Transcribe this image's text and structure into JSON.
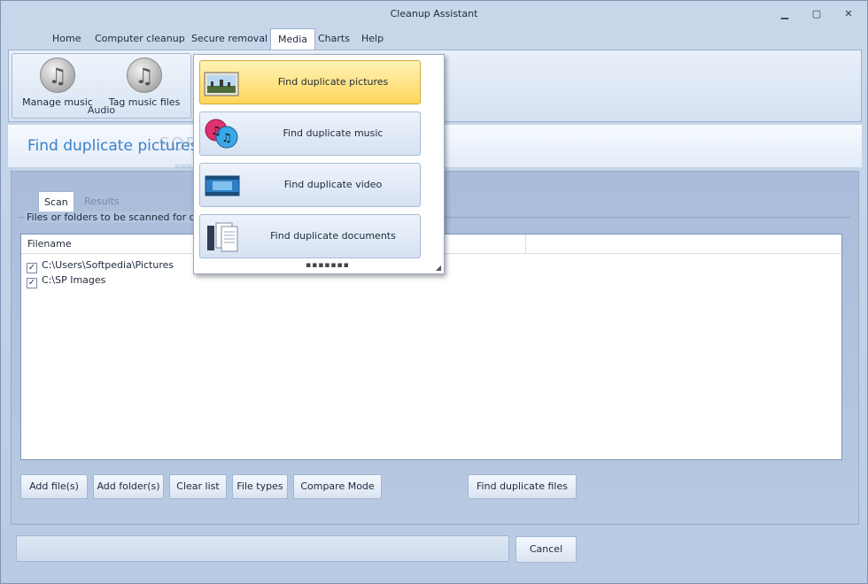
{
  "window": {
    "title": "Cleanup Assistant",
    "controls": {
      "minimize": "▁",
      "maximize": "▢",
      "close": "✕"
    }
  },
  "menu": {
    "items": [
      "Home",
      "Computer cleanup",
      "Secure removal",
      "Media",
      "Charts",
      "Help"
    ],
    "active": "Media"
  },
  "ribbon": {
    "groups": [
      {
        "label": "Audio",
        "buttons": [
          {
            "label": "Manage music",
            "icon": "music-note-icon"
          },
          {
            "label": "Tag music files",
            "icon": "music-tag-icon"
          }
        ]
      }
    ]
  },
  "header": {
    "title": "Find duplicate pictures",
    "watermark": "SOFTPEDIA",
    "watermark_url": "www.softpedia.com"
  },
  "tabs": [
    "Scan",
    "Results"
  ],
  "scan": {
    "groupbox_label": "Files or folders to be scanned for duplica",
    "columns": [
      "Filename",
      ""
    ],
    "rows": [
      {
        "checked": true,
        "path": "C:\\Users\\Softpedia\\Pictures"
      },
      {
        "checked": true,
        "path": "C:\\SP Images"
      }
    ]
  },
  "buttons": {
    "add_files": "Add file(s)",
    "add_folders": "Add folder(s)",
    "clear_list": "Clear list",
    "file_types": "File types",
    "compare_mode": "Compare Mode",
    "find_duplicates": "Find duplicate files",
    "cancel": "Cancel"
  },
  "media_menu": {
    "items": [
      {
        "label": "Find duplicate pictures",
        "icon": "picture-icon",
        "highlighted": true
      },
      {
        "label": "Find duplicate music",
        "icon": "music-icon",
        "highlighted": false
      },
      {
        "label": "Find duplicate video",
        "icon": "video-icon",
        "highlighted": false
      },
      {
        "label": "Find duplicate documents",
        "icon": "documents-icon",
        "highlighted": false
      }
    ]
  },
  "colors": {
    "accent_title": "#3a80c8",
    "highlight": "#ffd65a"
  }
}
